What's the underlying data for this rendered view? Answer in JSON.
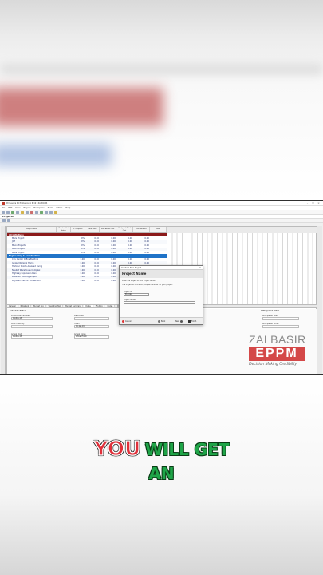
{
  "app": {
    "window_title": "Primavera P6 Professional R 19 : ZALBASIR",
    "menu": [
      "File",
      "Edit",
      "View",
      "Project",
      "Enterprise",
      "Tools",
      "Admin",
      "Help"
    ],
    "view_title": "Projects",
    "columns": [
      "Project Name",
      "Checked Out Status",
      "% Complete",
      "Data Date",
      "Total Actual Cost",
      "Budgeted Total Cost",
      "Cost Variance",
      "Start",
      "Finish"
    ],
    "rows": [
      {
        "type": "eps",
        "name": "All Initiatives",
        "values": [
          "",
          "",
          "",
          "",
          "",
          "",
          "",
          ""
        ]
      },
      {
        "type": "project",
        "name": "Mars Project",
        "values": [
          "",
          "0%",
          "0.00",
          "0.00",
          "0.00",
          "0.00",
          "",
          ""
        ]
      },
      {
        "type": "project",
        "name": "JCT",
        "values": [
          "",
          "0%",
          "0.00",
          "0.00",
          "0.00",
          "0.00",
          "",
          ""
        ]
      },
      {
        "type": "project",
        "name": "Moon Project2",
        "values": [
          "",
          "0%",
          "0.00",
          "0.00",
          "0.00",
          "0.00",
          "",
          ""
        ]
      },
      {
        "type": "project",
        "name": "Moon Project",
        "values": [
          "",
          "0%",
          "0.00",
          "0.00",
          "0.00",
          "0.00",
          "",
          ""
        ]
      },
      {
        "type": "project",
        "name": "Mars Project",
        "values": [
          "",
          "0%",
          "0.00",
          "0.00",
          "0.00",
          "0.00",
          "",
          ""
        ]
      },
      {
        "type": "eps-selected",
        "name": "Engineering & Construction",
        "values": [
          "",
          "",
          "",
          "",
          "",
          "",
          "",
          ""
        ]
      },
      {
        "type": "project",
        "name": "City Center Office Building",
        "values": [
          "",
          "1.00",
          "0.00",
          "0.00",
          "0.00",
          "0.00",
          "",
          ""
        ]
      },
      {
        "type": "project",
        "name": "Juniper Nursing Home",
        "values": [
          "",
          "1.00",
          "0.00",
          "0.00",
          "0.00",
          "0.00",
          "",
          ""
        ]
      },
      {
        "type": "project",
        "name": "Harbour Pointe Assisted Living",
        "values": [
          "",
          "1.00",
          "0.00",
          "0.00",
          "0.00",
          "0.00",
          "",
          ""
        ]
      },
      {
        "type": "project",
        "name": "Nesbitt Warehouse Complex",
        "values": [
          "",
          "1.00",
          "0.00",
          "0.00",
          "0.00",
          "0.00",
          "",
          ""
        ]
      },
      {
        "type": "project",
        "name": "Highway Expansion Plan",
        "values": [
          "",
          "1.00",
          "0.00",
          "0.00",
          "0.00",
          "0.00",
          "",
          ""
        ]
      },
      {
        "type": "project",
        "name": "Platinum Housing Project",
        "values": [
          "",
          "1.00",
          "0.00",
          "0.00",
          "0.00",
          "0.00",
          "",
          ""
        ]
      },
      {
        "type": "project",
        "name": "Baytown Electric Conversion",
        "values": [
          "",
          "1.00",
          "0.00",
          "0.00",
          "0.00",
          "0.00",
          "",
          ""
        ]
      }
    ],
    "bottom_tabs": [
      "General",
      "Notebook",
      "Budget Log",
      "Spending Plan",
      "Budget Summary",
      "Dates",
      "Funding",
      "Codes",
      "Defaults",
      "Resources",
      "Settings",
      "Calculations"
    ],
    "detail": {
      "section1": "Schedule Dates",
      "section2": "Anticipated Dates",
      "project_planned_start_label": "Project Planned Start",
      "project_planned_start": "01-Nov-18",
      "data_date_label": "Data Date",
      "data_date": "",
      "must_finish_by_label": "Must Finish By",
      "must_finish_by": "",
      "start_label": "Start",
      "finish_label": "Finish",
      "finish_value": "05-Jan-19",
      "actual_start_label": "Actual Start",
      "actual_start": "01-Nov-18",
      "actual_finish_label": "Actual Finish",
      "anticipated_start_label": "Anticipated Start",
      "anticipated_finish_label": "Anticipated Finish"
    }
  },
  "dialog": {
    "title": "Create a New Project",
    "heading": "Project Name",
    "line1": "Enter the Project ID and Project Name",
    "line2": "The Project ID is a short, unique identifier for your project.",
    "id_label": "Project ID",
    "id_value": "EC1990",
    "name_label": "Project Name",
    "name_value": "",
    "buttons": {
      "cancel": "Cancel",
      "back": "Back",
      "next": "Next",
      "finish": "Finish"
    }
  },
  "logo": {
    "top": "ZALBASIR",
    "box": "EPPM",
    "tagline": "Decision Making Credibility"
  },
  "caption": {
    "red": "YOU",
    "green1": "WILL GET",
    "green2": "AN"
  },
  "colors": {
    "eps_red": "#8b1a1a",
    "eps_selected": "#1f73c8",
    "caption_red": "#e0303a",
    "caption_green": "#1fa548",
    "logo_red": "#d44848"
  }
}
